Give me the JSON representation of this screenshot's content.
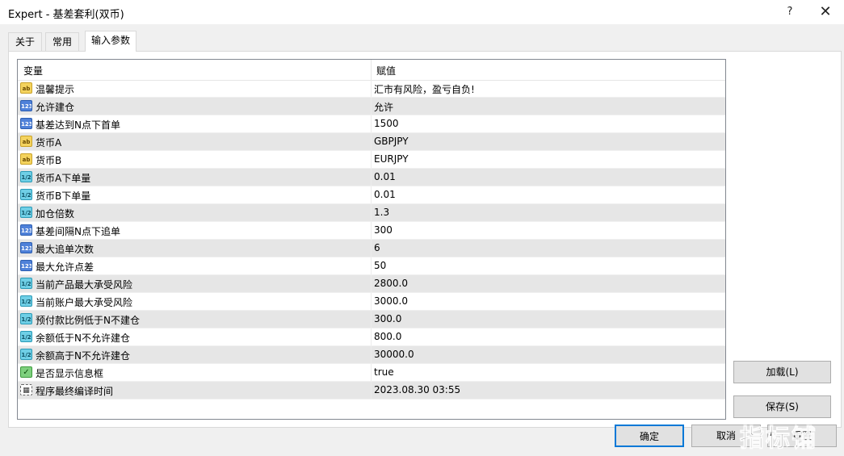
{
  "window": {
    "title": "Expert - 基差套利(双币)",
    "help_label": "?",
    "close_label": "✕"
  },
  "tabs": [
    {
      "label": "关于"
    },
    {
      "label": "常用"
    },
    {
      "label": "输入参数"
    }
  ],
  "grid": {
    "col_variable": "变量",
    "col_value": "赋值",
    "rows": [
      {
        "icon": "string",
        "icon_text": "ab",
        "name": "温馨提示",
        "value": "汇市有风险，盈亏自负!"
      },
      {
        "icon": "int",
        "icon_text": "123",
        "name": "允许建仓",
        "value": "允许"
      },
      {
        "icon": "int",
        "icon_text": "123",
        "name": "基差达到N点下首单",
        "value": "1500"
      },
      {
        "icon": "string",
        "icon_text": "ab",
        "name": "货币A",
        "value": "GBPJPY"
      },
      {
        "icon": "string",
        "icon_text": "ab",
        "name": "货币B",
        "value": "EURJPY"
      },
      {
        "icon": "double",
        "icon_text": "1/2",
        "name": "货币A下单量",
        "value": "0.01"
      },
      {
        "icon": "double",
        "icon_text": "1/2",
        "name": "货币B下单量",
        "value": "0.01"
      },
      {
        "icon": "double",
        "icon_text": "1/2",
        "name": "加仓倍数",
        "value": "1.3"
      },
      {
        "icon": "int",
        "icon_text": "123",
        "name": "基差间隔N点下追单",
        "value": "300"
      },
      {
        "icon": "int",
        "icon_text": "123",
        "name": "最大追单次数",
        "value": "6"
      },
      {
        "icon": "int",
        "icon_text": "123",
        "name": "最大允许点差",
        "value": "50"
      },
      {
        "icon": "double",
        "icon_text": "1/2",
        "name": "当前产品最大承受风险",
        "value": "2800.0"
      },
      {
        "icon": "double",
        "icon_text": "1/2",
        "name": "当前账户最大承受风险",
        "value": "3000.0"
      },
      {
        "icon": "double",
        "icon_text": "1/2",
        "name": "预付款比例低于N不建仓",
        "value": "300.0"
      },
      {
        "icon": "double",
        "icon_text": "1/2",
        "name": "余额低于N不允许建仓",
        "value": "800.0"
      },
      {
        "icon": "double",
        "icon_text": "1/2",
        "name": "余额高于N不允许建仓",
        "value": "30000.0"
      },
      {
        "icon": "bool",
        "icon_text": "✓",
        "name": "是否显示信息框",
        "value": "true"
      },
      {
        "icon": "datetime",
        "icon_text": "▦",
        "name": "程序最终编译时间",
        "value": "2023.08.30 03:55"
      }
    ]
  },
  "buttons": {
    "load": "加载(L)",
    "save": "保存(S)",
    "ok": "确定",
    "cancel": "取消",
    "reset": "重置"
  },
  "watermark": "指标铺"
}
